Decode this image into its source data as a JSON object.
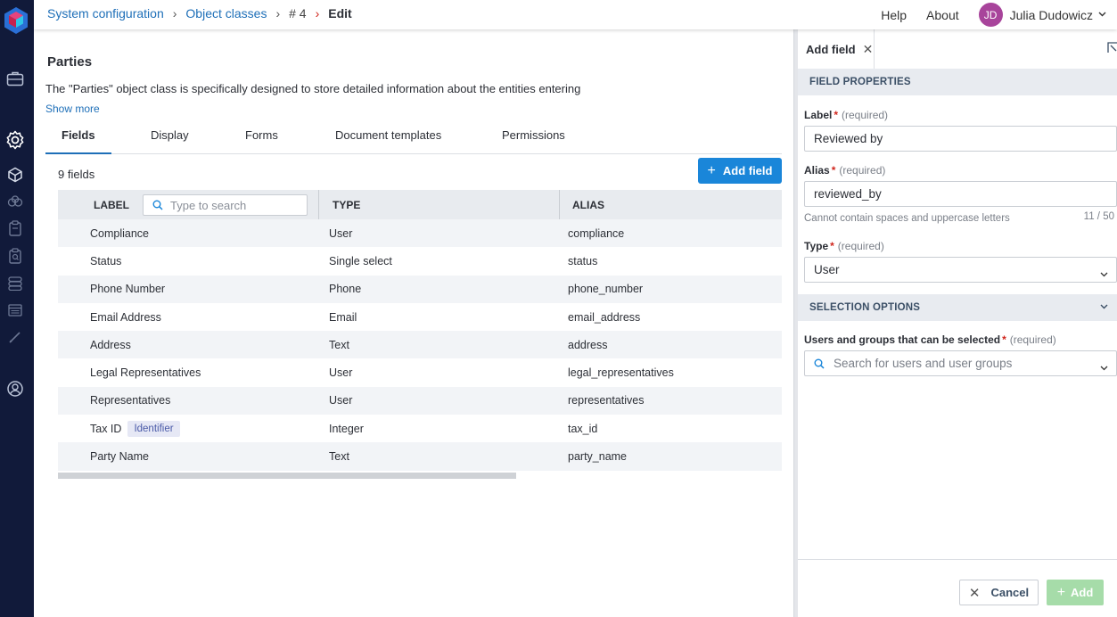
{
  "breadcrumb": {
    "items": [
      "System configuration",
      "Object classes",
      "# 4",
      "Edit"
    ]
  },
  "topnav": {
    "help": "Help",
    "about": "About",
    "user_initials": "JD",
    "user_name": "Julia Dudowicz"
  },
  "page": {
    "title": "Parties",
    "description": "The \"Parties\" object class is specifically designed to store detailed information about the entities entering",
    "show_more": "Show more"
  },
  "tabs": [
    {
      "label": "Fields",
      "active": true
    },
    {
      "label": "Display",
      "active": false
    },
    {
      "label": "Forms",
      "active": false
    },
    {
      "label": "Document templates",
      "active": false
    },
    {
      "label": "Permissions",
      "active": false
    }
  ],
  "fields_count": "9 fields",
  "add_field_button": "Add field",
  "table": {
    "columns": [
      "LABEL",
      "TYPE",
      "ALIAS"
    ],
    "search_placeholder": "Type to search",
    "rows": [
      {
        "label": "Compliance",
        "badge": "",
        "type": "User",
        "alias": "compliance"
      },
      {
        "label": "Status",
        "badge": "",
        "type": "Single select",
        "alias": "status"
      },
      {
        "label": "Phone Number",
        "badge": "",
        "type": "Phone",
        "alias": "phone_number"
      },
      {
        "label": "Email Address",
        "badge": "",
        "type": "Email",
        "alias": "email_address"
      },
      {
        "label": "Address",
        "badge": "",
        "type": "Text",
        "alias": "address"
      },
      {
        "label": "Legal Representatives",
        "badge": "",
        "type": "User",
        "alias": "legal_representatives"
      },
      {
        "label": "Representatives",
        "badge": "",
        "type": "User",
        "alias": "representatives"
      },
      {
        "label": "Tax ID",
        "badge": "Identifier",
        "type": "Integer",
        "alias": "tax_id"
      },
      {
        "label": "Party Name",
        "badge": "",
        "type": "Text",
        "alias": "party_name"
      }
    ]
  },
  "panel": {
    "tab_title": "Add field",
    "field_properties_title": "FIELD PROPERTIES",
    "label_field": {
      "label": "Label",
      "required": "(required)",
      "value": "Reviewed by"
    },
    "alias_field": {
      "label": "Alias",
      "required": "(required)",
      "value": "reviewed_by",
      "hint": "Cannot contain spaces and uppercase letters",
      "counter": "11 / 50"
    },
    "type_field": {
      "label": "Type",
      "required": "(required)",
      "value": "User"
    },
    "selection_options_title": "SELECTION OPTIONS",
    "users_field": {
      "label": "Users and groups that can be selected",
      "required": "(required)",
      "placeholder": "Search for users and user groups"
    },
    "cancel_button": "Cancel",
    "add_button": "Add"
  },
  "colors": {
    "rail": "#111a3a",
    "accent": "#1a86d9",
    "link": "#1e6fb8",
    "add_disabled": "#a6dca9",
    "required_star": "#d0261d",
    "avatar": "#a8449b"
  },
  "icons": [
    "app-logo-icon",
    "briefcase-icon",
    "gear-icon",
    "cube-icon",
    "cubes-icon",
    "clipboard-icon",
    "clipboard-search-icon",
    "stack-icon",
    "list-box-icon",
    "pen-icon",
    "user-circle-icon",
    "search-icon",
    "chevron-down-icon",
    "close-icon",
    "plus-icon",
    "expand-icon"
  ]
}
